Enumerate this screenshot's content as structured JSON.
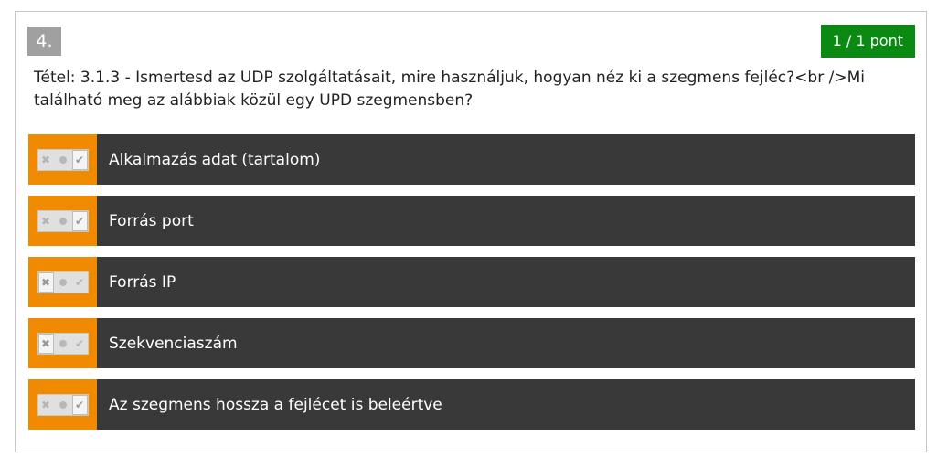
{
  "question": {
    "number": "4.",
    "score": "1 / 1 pont",
    "text": "Tétel: 3.1.3 - Ismertesd az UDP szolgáltatásait, mire használjuk, hogyan néz ki a szegmens fejléc?<br />Mi található meg az alábbiak közül egy UPD szegmensben?"
  },
  "options": [
    {
      "label": "Alkalmazás adat (tartalom)",
      "state": "true"
    },
    {
      "label": "Forrás port",
      "state": "true"
    },
    {
      "label": "Forrás IP",
      "state": "false"
    },
    {
      "label": "Szekvenciaszám",
      "state": "false"
    },
    {
      "label": "Az szegmens hossza a fejlécet is beleértve",
      "state": "true"
    }
  ],
  "icons": {
    "false": "x-icon",
    "neutral": "dot-icon",
    "true": "check-icon"
  },
  "colors": {
    "option_bg": "#393939",
    "toggle_cell": "#f08a00",
    "score_badge": "#0a8a13",
    "number_badge": "#a0a0a0"
  }
}
